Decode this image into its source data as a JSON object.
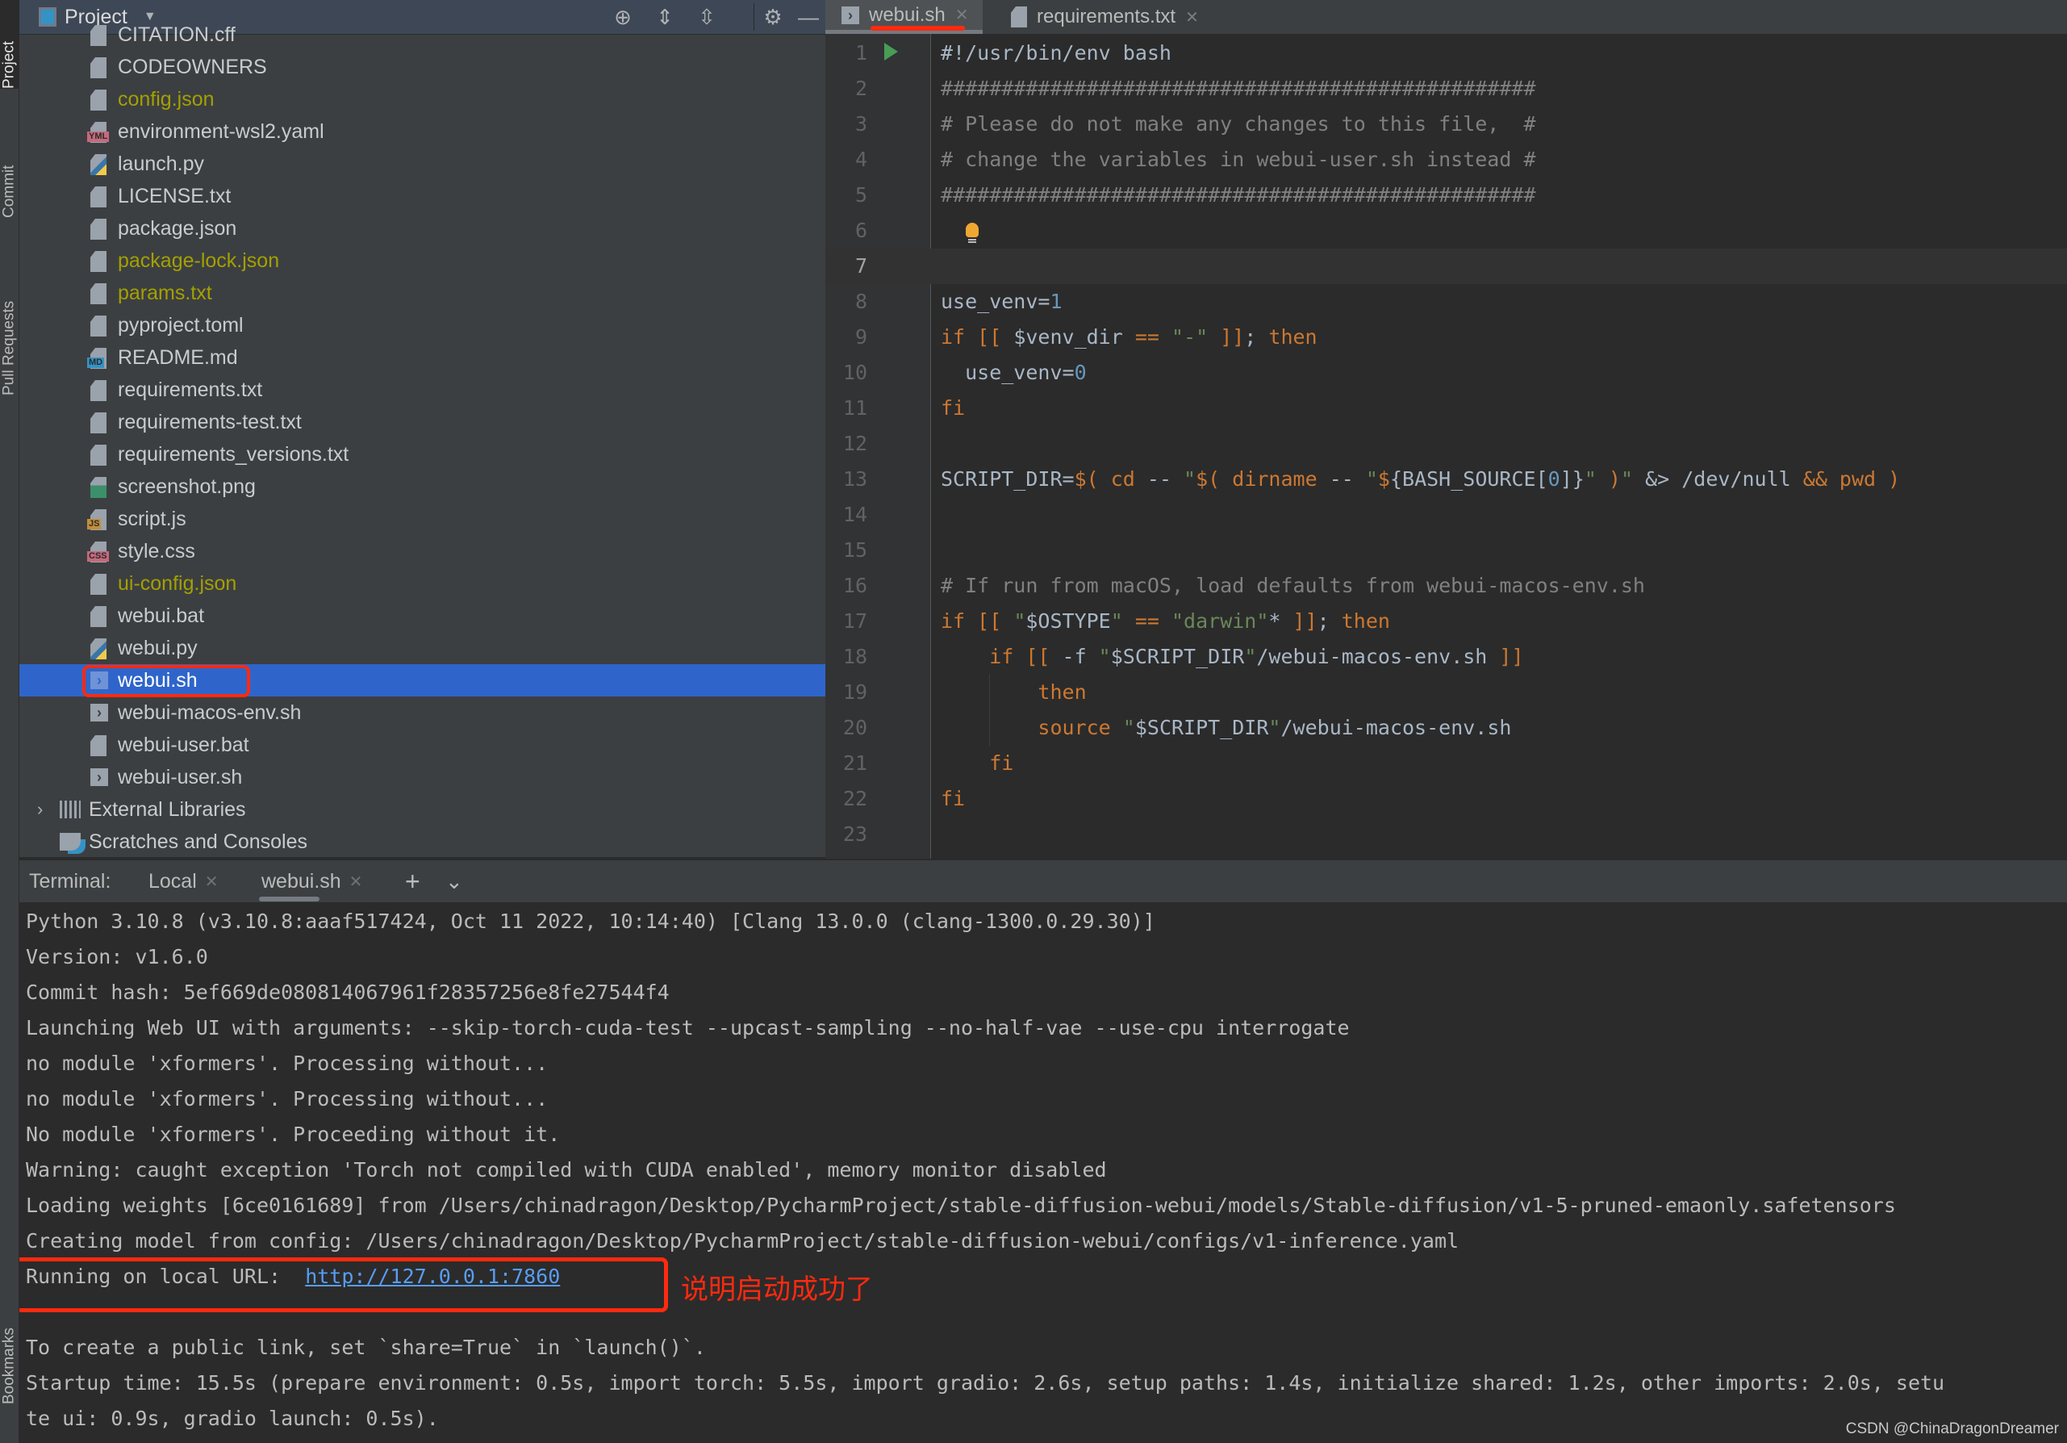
{
  "tool_strip": {
    "top": [
      "Project",
      "Commit",
      "Pull Requests"
    ],
    "bottom": [
      "Bookmarks"
    ]
  },
  "project_panel": {
    "title": "Project",
    "header_icons": [
      "locate-icon",
      "expand-all-icon",
      "collapse-all-icon",
      "gear-icon",
      "minimize-icon"
    ],
    "files": [
      {
        "name": "CITATION.cff",
        "type": "text",
        "modified": false
      },
      {
        "name": "CODEOWNERS",
        "type": "text",
        "modified": false
      },
      {
        "name": "config.json",
        "type": "json",
        "modified": true
      },
      {
        "name": "environment-wsl2.yaml",
        "type": "yaml",
        "modified": false
      },
      {
        "name": "launch.py",
        "type": "python",
        "modified": false
      },
      {
        "name": "LICENSE.txt",
        "type": "text",
        "modified": false
      },
      {
        "name": "package.json",
        "type": "json",
        "modified": false
      },
      {
        "name": "package-lock.json",
        "type": "json",
        "modified": true
      },
      {
        "name": "params.txt",
        "type": "text",
        "modified": true
      },
      {
        "name": "pyproject.toml",
        "type": "toml",
        "modified": false
      },
      {
        "name": "README.md",
        "type": "markdown",
        "modified": false
      },
      {
        "name": "requirements.txt",
        "type": "text",
        "modified": false
      },
      {
        "name": "requirements-test.txt",
        "type": "text",
        "modified": false
      },
      {
        "name": "requirements_versions.txt",
        "type": "text",
        "modified": false
      },
      {
        "name": "screenshot.png",
        "type": "image",
        "modified": false
      },
      {
        "name": "script.js",
        "type": "javascript",
        "modified": false
      },
      {
        "name": "style.css",
        "type": "css",
        "modified": false
      },
      {
        "name": "ui-config.json",
        "type": "json",
        "modified": true
      },
      {
        "name": "webui.bat",
        "type": "text",
        "modified": false
      },
      {
        "name": "webui.py",
        "type": "python",
        "modified": false
      },
      {
        "name": "webui.sh",
        "type": "shell",
        "modified": false,
        "selected": true
      },
      {
        "name": "webui-macos-env.sh",
        "type": "shell",
        "modified": false
      },
      {
        "name": "webui-user.bat",
        "type": "text",
        "modified": false
      },
      {
        "name": "webui-user.sh",
        "type": "shell",
        "modified": false
      }
    ],
    "roots": [
      {
        "name": "External Libraries",
        "expandable": true
      },
      {
        "name": "Scratches and Consoles",
        "expandable": false
      }
    ]
  },
  "editor": {
    "tabs": [
      {
        "label": "webui.sh",
        "active": true
      },
      {
        "label": "requirements.txt",
        "active": false
      }
    ],
    "current_line": 7,
    "lines": [
      [
        {
          "t": "#!/usr/bin/env bash",
          "c": "var"
        }
      ],
      [
        {
          "t": "#################################################",
          "c": "cmt"
        }
      ],
      [
        {
          "t": "# Please do not make any changes to this file,  #",
          "c": "cmt"
        }
      ],
      [
        {
          "t": "# change the variables in webui-user.sh instead #",
          "c": "cmt"
        }
      ],
      [
        {
          "t": "#################################################",
          "c": "cmt"
        }
      ],
      [],
      [],
      [
        {
          "t": "use_venv=",
          "c": "var"
        },
        {
          "t": "1",
          "c": "num"
        }
      ],
      [
        {
          "t": "if [[ ",
          "c": "kw"
        },
        {
          "t": "$venv_dir ",
          "c": "var"
        },
        {
          "t": "== ",
          "c": "kw"
        },
        {
          "t": "\"-\"",
          "c": "str"
        },
        {
          "t": " ]]",
          "c": "kw"
        },
        {
          "t": "; ",
          "c": "var"
        },
        {
          "t": "then",
          "c": "kw"
        }
      ],
      [
        {
          "t": "  use_venv=",
          "c": "var"
        },
        {
          "t": "0",
          "c": "num"
        }
      ],
      [
        {
          "t": "fi",
          "c": "kw"
        }
      ],
      [],
      [
        {
          "t": "SCRIPT_DIR=",
          "c": "var"
        },
        {
          "t": "$( cd ",
          "c": "kw"
        },
        {
          "t": "-- ",
          "c": "var"
        },
        {
          "t": "\"",
          "c": "str"
        },
        {
          "t": "$( dirname ",
          "c": "kw"
        },
        {
          "t": "-- ",
          "c": "var"
        },
        {
          "t": "\"",
          "c": "str"
        },
        {
          "t": "$",
          "c": "kw"
        },
        {
          "t": "{BASH_SOURCE[",
          "c": "var"
        },
        {
          "t": "0",
          "c": "num"
        },
        {
          "t": "]}",
          "c": "var"
        },
        {
          "t": "\"",
          "c": "str"
        },
        {
          "t": " )",
          "c": "kw"
        },
        {
          "t": "\"",
          "c": "str"
        },
        {
          "t": " &> /dev/null ",
          "c": "var"
        },
        {
          "t": "&& pwd )",
          "c": "kw"
        }
      ],
      [],
      [],
      [
        {
          "t": "# If run from macOS, load defaults from webui-macos-env.sh",
          "c": "cmt"
        }
      ],
      [
        {
          "t": "if [[ ",
          "c": "kw"
        },
        {
          "t": "\"",
          "c": "str"
        },
        {
          "t": "$OSTYPE",
          "c": "var"
        },
        {
          "t": "\" ",
          "c": "str"
        },
        {
          "t": "== ",
          "c": "kw"
        },
        {
          "t": "\"darwin\"",
          "c": "str"
        },
        {
          "t": "* ",
          "c": "var"
        },
        {
          "t": "]]",
          "c": "kw"
        },
        {
          "t": "; ",
          "c": "var"
        },
        {
          "t": "then",
          "c": "kw"
        }
      ],
      [
        {
          "t": "    if [[ ",
          "c": "kw"
        },
        {
          "t": "-f ",
          "c": "var"
        },
        {
          "t": "\"",
          "c": "str"
        },
        {
          "t": "$SCRIPT_DIR",
          "c": "var"
        },
        {
          "t": "\"",
          "c": "str"
        },
        {
          "t": "/webui-macos-env.sh ",
          "c": "var"
        },
        {
          "t": "]]",
          "c": "kw"
        }
      ],
      [
        {
          "t": "        then",
          "c": "kw"
        }
      ],
      [
        {
          "t": "        source ",
          "c": "kw"
        },
        {
          "t": "\"",
          "c": "str"
        },
        {
          "t": "$SCRIPT_DIR",
          "c": "var"
        },
        {
          "t": "\"",
          "c": "str"
        },
        {
          "t": "/webui-macos-env.sh",
          "c": "var"
        }
      ],
      [
        {
          "t": "    fi",
          "c": "kw"
        }
      ],
      [
        {
          "t": "fi",
          "c": "kw"
        }
      ],
      []
    ]
  },
  "terminal": {
    "label": "Terminal:",
    "tabs": [
      {
        "label": "Local",
        "active": false
      },
      {
        "label": "webui.sh",
        "active": true
      }
    ],
    "lines": [
      "Python 3.10.8 (v3.10.8:aaaf517424, Oct 11 2022, 10:14:40) [Clang 13.0.0 (clang-1300.0.29.30)]",
      "Version: v1.6.0",
      "Commit hash: 5ef669de080814067961f28357256e8fe27544f4",
      "Launching Web UI with arguments: --skip-torch-cuda-test --upcast-sampling --no-half-vae --use-cpu interrogate",
      "no module 'xformers'. Processing without...",
      "no module 'xformers'. Processing without...",
      "No module 'xformers'. Proceeding without it.",
      "Warning: caught exception 'Torch not compiled with CUDA enabled', memory monitor disabled",
      "Loading weights [6ce0161689] from /Users/chinadragon/Desktop/PycharmProject/stable-diffusion-webui/models/Stable-diffusion/v1-5-pruned-emaonly.safetensors",
      "Creating model from config: /Users/chinadragon/Desktop/PycharmProject/stable-diffusion-webui/configs/v1-inference.yaml"
    ],
    "url_line": {
      "prefix": "Running on local URL:  ",
      "url": "http://127.0.0.1:7860"
    },
    "after_lines": [
      "",
      "To create a public link, set `share=True` in `launch()`.",
      "Startup time: 15.5s (prepare environment: 0.5s, import torch: 5.5s, import gradio: 2.6s, setup paths: 1.4s, initialize shared: 1.2s, other imports: 2.0s, setu",
      "te ui: 0.9s, gradio launch: 0.5s)."
    ],
    "annotation": "说明启动成功了"
  },
  "watermark": "CSDN @ChinaDragonDreamer",
  "colors": {
    "selection": "#2f65ca",
    "highlight_red": "#ff2a0f",
    "modified_file": "#a4a000",
    "keyword": "#cc7832",
    "string": "#6a8759",
    "number": "#6897bb",
    "link": "#589df6"
  }
}
